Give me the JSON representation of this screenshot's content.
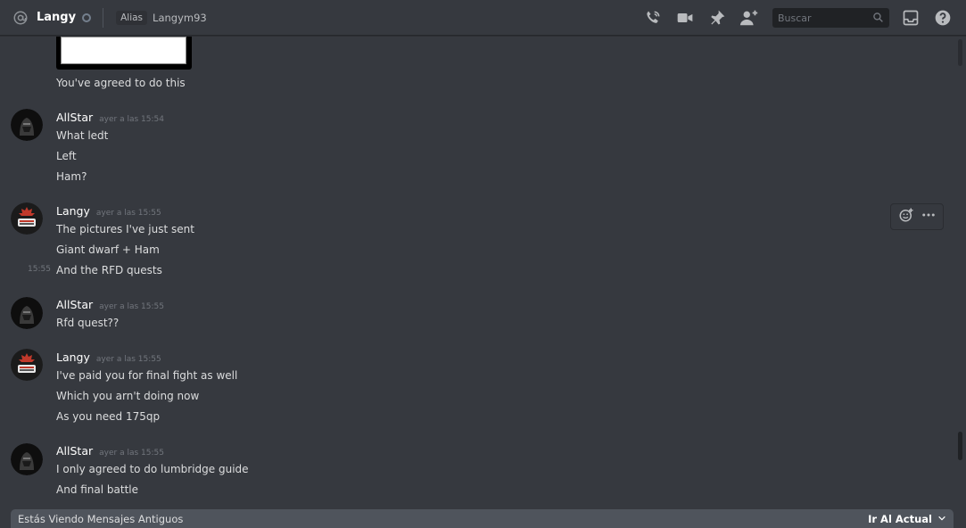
{
  "header": {
    "channel_name": "Langy",
    "alias_tag": "Alias",
    "alias_value": "Langym93",
    "search_placeholder": "Buscar",
    "icons": [
      "at-icon",
      "call-icon",
      "video-icon",
      "pin-icon",
      "add-friend-icon",
      "search-icon",
      "inbox-icon",
      "help-icon"
    ]
  },
  "messages": {
    "m0_text": "You've agreed to do this",
    "g1": {
      "author": "AllStar",
      "time": "ayer a las 15:54",
      "lines": [
        "What ledt",
        "Left",
        "Ham?"
      ]
    },
    "g2": {
      "author": "Langy",
      "time": "ayer a las 15:55",
      "lines": [
        "The pictures I've just sent",
        "Giant dwarf + Ham",
        "And the RFD quests"
      ],
      "side_time": "15:55"
    },
    "g3": {
      "author": "AllStar",
      "time": "ayer a las 15:55",
      "lines": [
        "Rfd quest??"
      ]
    },
    "g4": {
      "author": "Langy",
      "time": "ayer a las 15:55",
      "lines": [
        "I've paid you for final fight as well",
        "Which you arn't doing now",
        "As you need 175qp"
      ]
    },
    "g5": {
      "author": "AllStar",
      "time": "ayer a las 15:55",
      "lines": [
        "I only agreed to do lumbridge guide",
        "And final battle"
      ]
    }
  },
  "banner": {
    "text": "Estás Viendo Mensajes Antiguos",
    "jump_label": "Ir Al Actual"
  },
  "colors": {
    "background": "#36393f",
    "banner": "#4f545c",
    "langy_avatar_accent": "#c0392b"
  }
}
